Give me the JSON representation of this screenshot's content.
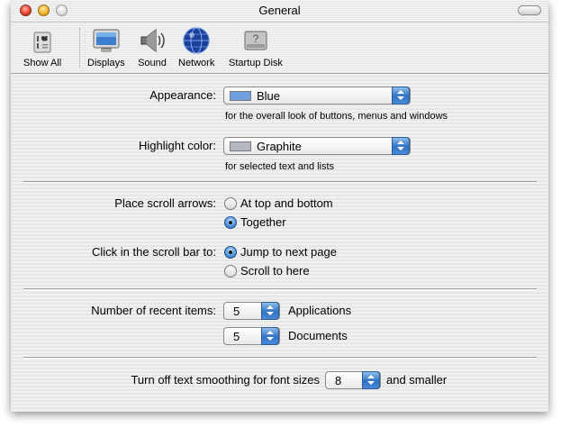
{
  "window": {
    "title": "General"
  },
  "toolbar": {
    "items": [
      {
        "label": "Show All",
        "icon": "show-all-icon"
      },
      {
        "label": "Displays",
        "icon": "display-icon"
      },
      {
        "label": "Sound",
        "icon": "speaker-icon"
      },
      {
        "label": "Network",
        "icon": "globe-icon"
      },
      {
        "label": "Startup Disk",
        "icon": "startup-disk-icon"
      }
    ]
  },
  "appearance": {
    "label": "Appearance:",
    "value": "Blue",
    "swatch_color": "#6f9fe0",
    "hint": "for the overall look of buttons, menus and windows"
  },
  "highlight": {
    "label": "Highlight color:",
    "value": "Graphite",
    "swatch_color": "#b3b9c3",
    "hint": "for selected text and lists"
  },
  "scroll_arrows": {
    "label": "Place scroll arrows:",
    "options": [
      {
        "label": "At top and bottom",
        "selected": false
      },
      {
        "label": "Together",
        "selected": true
      }
    ]
  },
  "scroll_click": {
    "label": "Click in the scroll bar to:",
    "options": [
      {
        "label": "Jump to next page",
        "selected": true
      },
      {
        "label": "Scroll to here",
        "selected": false
      }
    ]
  },
  "recent_items": {
    "label": "Number of recent items:",
    "applications": {
      "value": "5",
      "suffix": "Applications"
    },
    "documents": {
      "value": "5",
      "suffix": "Documents"
    }
  },
  "smoothing": {
    "label": "Turn off text smoothing for font sizes",
    "value": "8",
    "suffix": "and smaller"
  },
  "colors": {
    "accent": "#3b7bd0"
  }
}
